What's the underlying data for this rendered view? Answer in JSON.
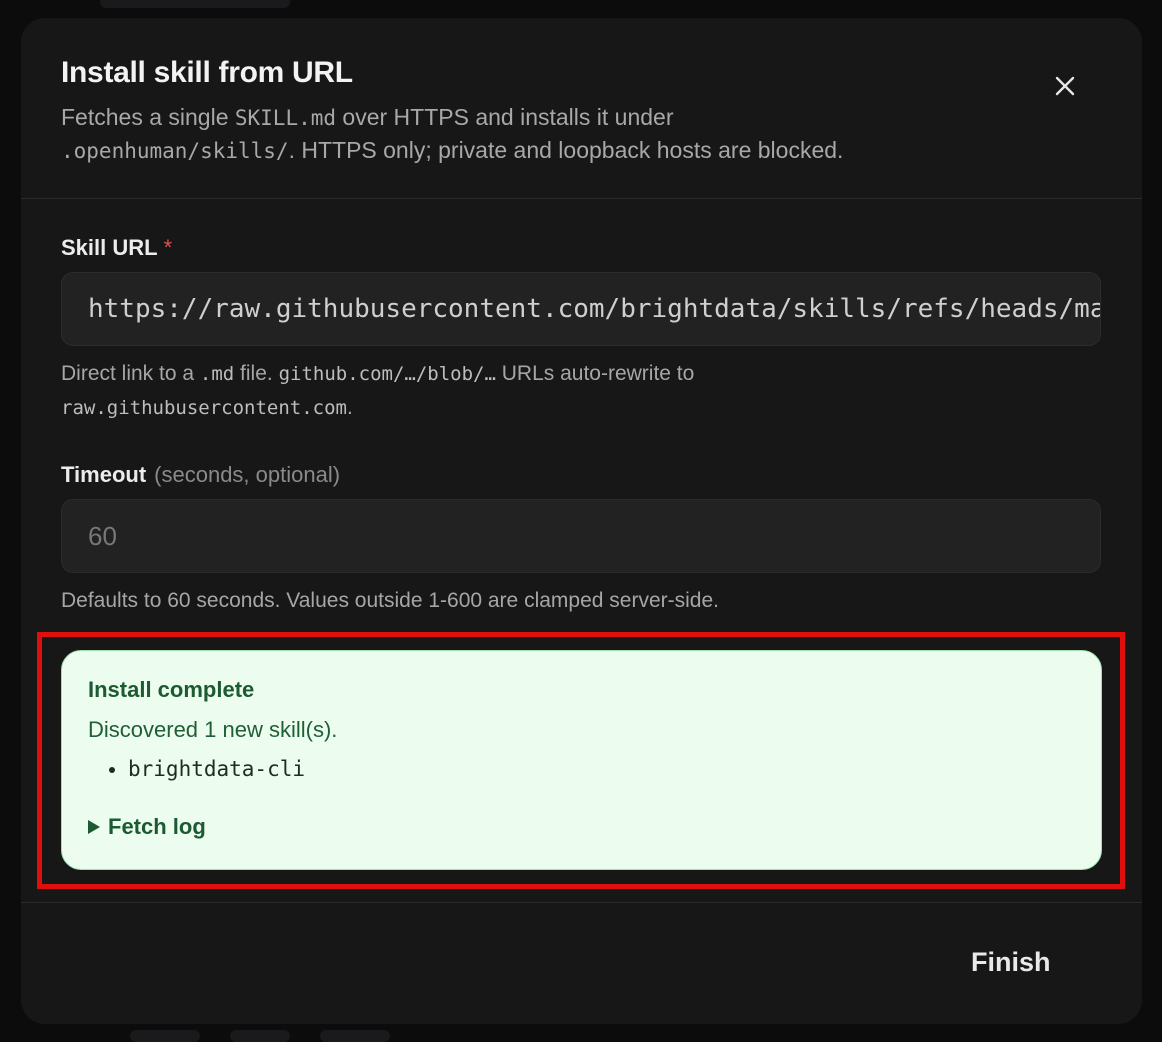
{
  "modal": {
    "title": "Install skill from URL",
    "description": {
      "part1": "Fetches a single ",
      "code1": "SKILL.md",
      "part2": " over HTTPS and installs it under",
      "code2": ".openhuman/skills/",
      "part3": ". HTTPS only; private and loopback hosts are blocked."
    },
    "close_icon": "close-icon"
  },
  "skill_url": {
    "label": "Skill URL",
    "required_mark": "*",
    "value": "https://raw.githubusercontent.com/brightdata/skills/refs/heads/main/skills/brightdata-cli/SKILL.md",
    "help": {
      "part1": "Direct link to a ",
      "code1": ".md",
      "part2": " file. ",
      "code2": "github.com/…/blob/…",
      "part3": " URLs auto-rewrite to",
      "code3": "raw.githubusercontent.com",
      "part4": "."
    }
  },
  "timeout": {
    "label": "Timeout",
    "optional_hint": "(seconds, optional)",
    "placeholder": "60",
    "help": "Defaults to 60 seconds. Values outside 1-600 are clamped server-side."
  },
  "result": {
    "title": "Install complete",
    "message": "Discovered 1 new skill(s).",
    "skills": [
      "brightdata-cli"
    ],
    "fetch_log_label": "Fetch log"
  },
  "footer": {
    "finish_label": "Finish"
  },
  "colors": {
    "modal_bg": "#171717",
    "success_bg": "#ecfcef",
    "success_text": "#1c5a32",
    "highlight": "#e10e0e",
    "required": "#e05252"
  }
}
